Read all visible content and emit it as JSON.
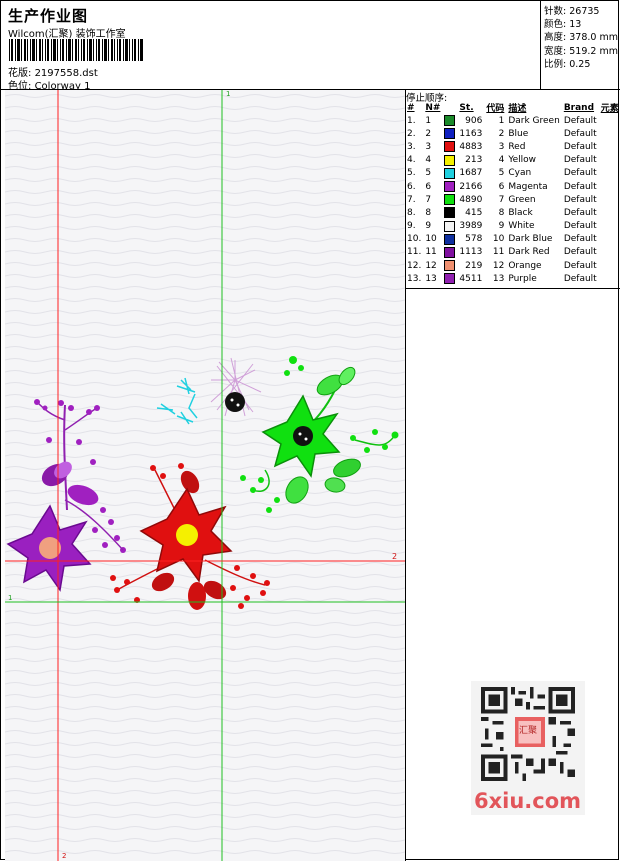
{
  "header": {
    "title": "生产作业图",
    "studio": "Wilcom(汇聚) 装饰工作室",
    "design_label": "花版:",
    "design_value": "2197558.dst",
    "colorway_label": "色位:",
    "colorway_value": "Colorway 1"
  },
  "stats": {
    "stitches_label": "针数:",
    "stitches_value": "26735",
    "colors_label": "颜色:",
    "colors_value": "13",
    "height_label": "高度:",
    "height_value": "378.0 mm",
    "width_label": "宽度:",
    "width_value": "519.2 mm",
    "scale_label": "比例:",
    "scale_value": "0.25"
  },
  "stop_sequence": {
    "title": "停止顺序:",
    "headers": {
      "idx": "#",
      "no": "N#",
      "st": "St.",
      "code": "代码",
      "desc": "描述",
      "brand": "Brand",
      "elem": "元素"
    },
    "rows": [
      {
        "idx": "1.",
        "no": "1",
        "color": "#1a8a2a",
        "st": "906",
        "code": "1",
        "desc": "Dark Green",
        "brand": "Default"
      },
      {
        "idx": "2.",
        "no": "2",
        "color": "#1020c0",
        "st": "1163",
        "code": "2",
        "desc": "Blue",
        "brand": "Default"
      },
      {
        "idx": "3.",
        "no": "3",
        "color": "#e01010",
        "st": "4883",
        "code": "3",
        "desc": "Red",
        "brand": "Default"
      },
      {
        "idx": "4.",
        "no": "4",
        "color": "#f5f000",
        "st": "213",
        "code": "4",
        "desc": "Yellow",
        "brand": "Default"
      },
      {
        "idx": "5.",
        "no": "5",
        "color": "#20d0e0",
        "st": "1687",
        "code": "5",
        "desc": "Cyan",
        "brand": "Default"
      },
      {
        "idx": "6.",
        "no": "6",
        "color": "#a020c0",
        "st": "2166",
        "code": "6",
        "desc": "Magenta",
        "brand": "Default"
      },
      {
        "idx": "7.",
        "no": "7",
        "color": "#10e010",
        "st": "4890",
        "code": "7",
        "desc": "Green",
        "brand": "Default"
      },
      {
        "idx": "8.",
        "no": "8",
        "color": "#000000",
        "st": "415",
        "code": "8",
        "desc": "Black",
        "brand": "Default"
      },
      {
        "idx": "9.",
        "no": "9",
        "color": "#f4f4f4",
        "st": "3989",
        "code": "9",
        "desc": "White",
        "brand": "Default"
      },
      {
        "idx": "10.",
        "no": "10",
        "color": "#1030a0",
        "st": "578",
        "code": "10",
        "desc": "Dark Blue",
        "brand": "Default"
      },
      {
        "idx": "11.",
        "no": "11",
        "color": "#8010a0",
        "st": "1113",
        "code": "11",
        "desc": "Dark Red",
        "brand": "Default"
      },
      {
        "idx": "12.",
        "no": "12",
        "color": "#f09070",
        "st": "219",
        "code": "12",
        "desc": "Orange",
        "brand": "Default"
      },
      {
        "idx": "13.",
        "no": "13",
        "color": "#9020b0",
        "st": "4511",
        "code": "13",
        "desc": "Purple",
        "brand": "Default"
      }
    ]
  },
  "guides": {
    "v1_label": "1",
    "v2_label": "2",
    "h1_label": "1",
    "h2_label": "2"
  },
  "watermark": "6xiu.com",
  "qr_caption": "汇聚"
}
